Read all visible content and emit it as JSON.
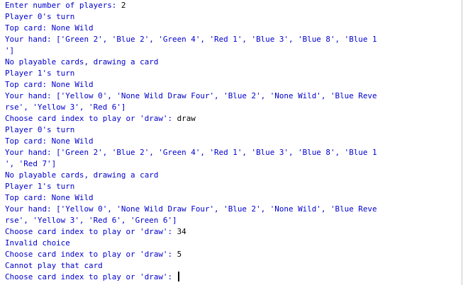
{
  "console": {
    "lines": [
      {
        "text": "Enter number of players: ",
        "input": "2"
      },
      {
        "text": "Player 0's turn"
      },
      {
        "text": "Top card: None Wild"
      },
      {
        "text": "Your hand: ['Green 2', 'Blue 2', 'Green 4', 'Red 1', 'Blue 3', 'Blue 8', 'Blue 1"
      },
      {
        "text": "']"
      },
      {
        "text": "No playable cards, drawing a card"
      },
      {
        "text": "Player 1's turn"
      },
      {
        "text": "Top card: None Wild"
      },
      {
        "text": "Your hand: ['Yellow 0', 'None Wild Draw Four', 'Blue 2', 'None Wild', 'Blue Reve"
      },
      {
        "text": "rse', 'Yellow 3', 'Red 6']"
      },
      {
        "text": "Choose card index to play or 'draw': ",
        "input": "draw"
      },
      {
        "text": "Player 0's turn"
      },
      {
        "text": "Top card: None Wild"
      },
      {
        "text": "Your hand: ['Green 2', 'Blue 2', 'Green 4', 'Red 1', 'Blue 3', 'Blue 8', 'Blue 1"
      },
      {
        "text": "', 'Red 7']"
      },
      {
        "text": "No playable cards, drawing a card"
      },
      {
        "text": "Player 1's turn"
      },
      {
        "text": "Top card: None Wild"
      },
      {
        "text": "Your hand: ['Yellow 0', 'None Wild Draw Four', 'Blue 2', 'None Wild', 'Blue Reve"
      },
      {
        "text": "rse', 'Yellow 3', 'Red 6', 'Green 6']"
      },
      {
        "text": "Choose card index to play or 'draw': ",
        "input": "34"
      },
      {
        "text": "Invalid choice"
      },
      {
        "text": "Choose card index to play or 'draw': ",
        "input": "5"
      },
      {
        "text": "Cannot play that card"
      },
      {
        "text": "Choose card index to play or 'draw': ",
        "input": "",
        "caret": true
      }
    ]
  }
}
